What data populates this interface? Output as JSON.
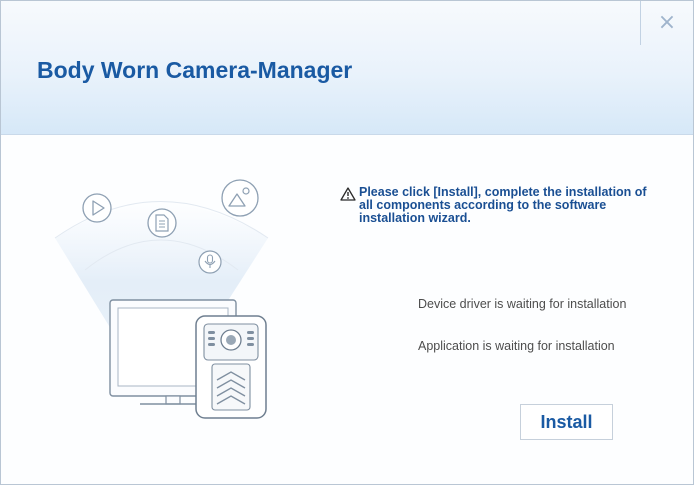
{
  "window": {
    "title": "Body Worn Camera-Manager",
    "close_glyph": "×"
  },
  "notice": {
    "icon": "warning-triangle-icon",
    "text": "Please click [Install], complete the installation of all components according to the software installation wizard."
  },
  "status": {
    "driver": "Device driver is waiting for installation",
    "application": "Application is waiting for installation"
  },
  "install_button": {
    "label": "Install"
  },
  "illustration": {
    "icons": [
      "play-icon",
      "document-icon",
      "image-icon",
      "microphone-icon",
      "monitor-icon",
      "body-camera-icon"
    ]
  },
  "colors": {
    "accent": "#1a5aa3",
    "header_gradient_top": "#f7fafd",
    "header_gradient_bottom": "#d6e8f8",
    "notice_text": "#1a4f93",
    "status_text": "#4d4d4d"
  }
}
